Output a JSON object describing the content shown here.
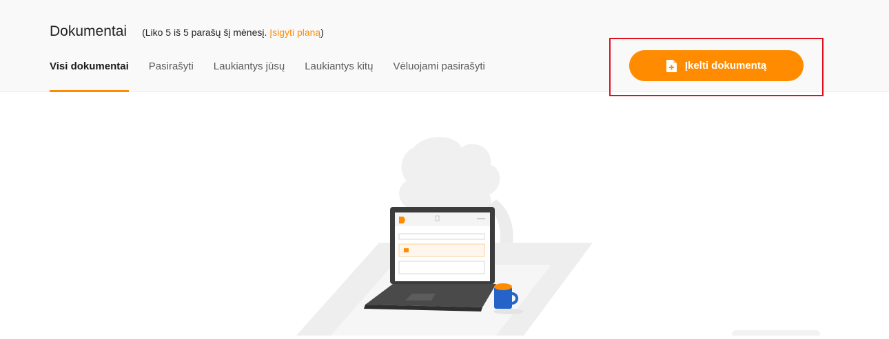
{
  "header": {
    "title": "Dokumentai",
    "quota_prefix": "(Liko 5 iš 5 parašų šį mėnesį.",
    "quota_link": "Įsigyti planą",
    "quota_suffix": ")"
  },
  "tabs": [
    {
      "label": "Visi dokumentai",
      "active": true
    },
    {
      "label": "Pasirašyti",
      "active": false
    },
    {
      "label": "Laukiantys jūsų",
      "active": false
    },
    {
      "label": "Laukiantys kitų",
      "active": false
    },
    {
      "label": "Vėluojami pasirašyti",
      "active": false
    }
  ],
  "upload_button": {
    "label": "Įkelti dokumentą",
    "icon": "file-plus-icon"
  },
  "illustration": {
    "name": "empty-state-laptop-illustration"
  },
  "colors": {
    "accent": "#ff8c00",
    "highlight": "#e0101f",
    "header_bg": "#f9f9f9"
  }
}
